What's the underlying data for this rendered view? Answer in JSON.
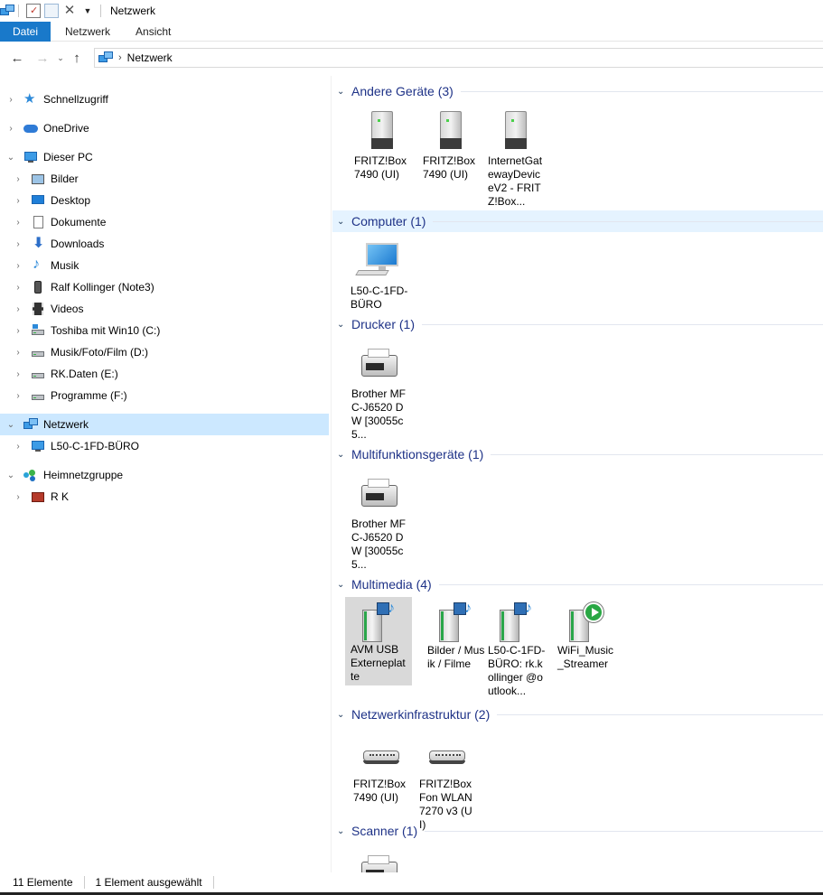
{
  "window": {
    "title": "Netzwerk"
  },
  "ribbon": {
    "tabs": [
      {
        "label": "Datei",
        "active": true
      },
      {
        "label": "Netzwerk"
      },
      {
        "label": "Ansicht"
      }
    ]
  },
  "address": {
    "path": [
      "Netzwerk"
    ],
    "separator": "›"
  },
  "nav": {
    "items": [
      {
        "label": "Schnellzugriff",
        "icon": "star-icon",
        "level": 0
      },
      {
        "label": "OneDrive",
        "icon": "cloud-icon",
        "level": 0
      },
      {
        "label": "Dieser PC",
        "icon": "computer-icon",
        "level": 0,
        "expanded": true
      },
      {
        "label": "Bilder",
        "icon": "pictures-icon",
        "level": 1
      },
      {
        "label": "Desktop",
        "icon": "desktop-icon",
        "level": 1
      },
      {
        "label": "Dokumente",
        "icon": "documents-icon",
        "level": 1
      },
      {
        "label": "Downloads",
        "icon": "download-icon",
        "level": 1
      },
      {
        "label": "Musik",
        "icon": "music-icon",
        "level": 1
      },
      {
        "label": "Ralf Kollinger (Note3)",
        "icon": "phone-icon",
        "level": 1
      },
      {
        "label": "Videos",
        "icon": "video-icon",
        "level": 1
      },
      {
        "label": "Toshiba mit Win10 (C:)",
        "icon": "drive-icon",
        "level": 1
      },
      {
        "label": "Musik/Foto/Film (D:)",
        "icon": "drive-icon",
        "level": 1
      },
      {
        "label": "RK.Daten (E:)",
        "icon": "drive-icon",
        "level": 1
      },
      {
        "label": "Programme (F:)",
        "icon": "drive-icon",
        "level": 1
      },
      {
        "label": "Netzwerk",
        "icon": "network-icon",
        "level": 0,
        "expanded": true,
        "selected": true
      },
      {
        "label": "L50-C-1FD-BÜRO",
        "icon": "computer-icon",
        "level": 1
      },
      {
        "label": "Heimnetzgruppe",
        "icon": "homegroup-icon",
        "level": 0,
        "expanded": true
      },
      {
        "label": "R K",
        "icon": "user-icon",
        "level": 1
      }
    ]
  },
  "groups": [
    {
      "title": "Andere Geräte (3)",
      "items": [
        {
          "label": "FRITZ!Box 7490 (UI)",
          "icon": "device-icon"
        },
        {
          "label": "FRITZ!Box 7490 (UI)",
          "icon": "device-icon"
        },
        {
          "label": "InternetGatewayDeviceV2 - FRITZ!Box...",
          "icon": "device-icon"
        }
      ]
    },
    {
      "title": "Computer (1)",
      "highlight": true,
      "items": [
        {
          "label": "L50-C-1FD-BÜRO",
          "icon": "computer-icon"
        }
      ]
    },
    {
      "title": "Drucker (1)",
      "items": [
        {
          "label": "Brother MFC-J6520 DW [30055c5...",
          "icon": "printer-icon"
        }
      ]
    },
    {
      "title": "Multifunktionsgeräte (1)",
      "items": [
        {
          "label": "Brother MFC-J6520 DW [30055c5...",
          "icon": "printer-icon"
        }
      ]
    },
    {
      "title": "Multimedia (4)",
      "items": [
        {
          "label": "AVM USB Externeplatte",
          "icon": "media-server-icon",
          "selected": true
        },
        {
          "label": "Bilder / Musik / Filme",
          "icon": "media-server-icon"
        },
        {
          "label": "L50-C-1FD-BÜRO: rk.kollinger @outlook...",
          "icon": "media-server-icon"
        },
        {
          "label": "WiFi_Music _Streamer",
          "icon": "media-player-icon"
        }
      ]
    },
    {
      "title": "Netzwerkinfrastruktur (2)",
      "items": [
        {
          "label": "FRITZ!Box 7490 (UI)",
          "icon": "router-icon"
        },
        {
          "label": "FRITZ!Box Fon WLAN 7270 v3 (UI)",
          "icon": "router-icon"
        }
      ]
    },
    {
      "title": "Scanner (1)",
      "items": [
        {
          "label": "",
          "icon": "printer-icon"
        }
      ]
    }
  ],
  "status": {
    "count": "11 Elemente",
    "selection": "1 Element ausgewählt"
  }
}
